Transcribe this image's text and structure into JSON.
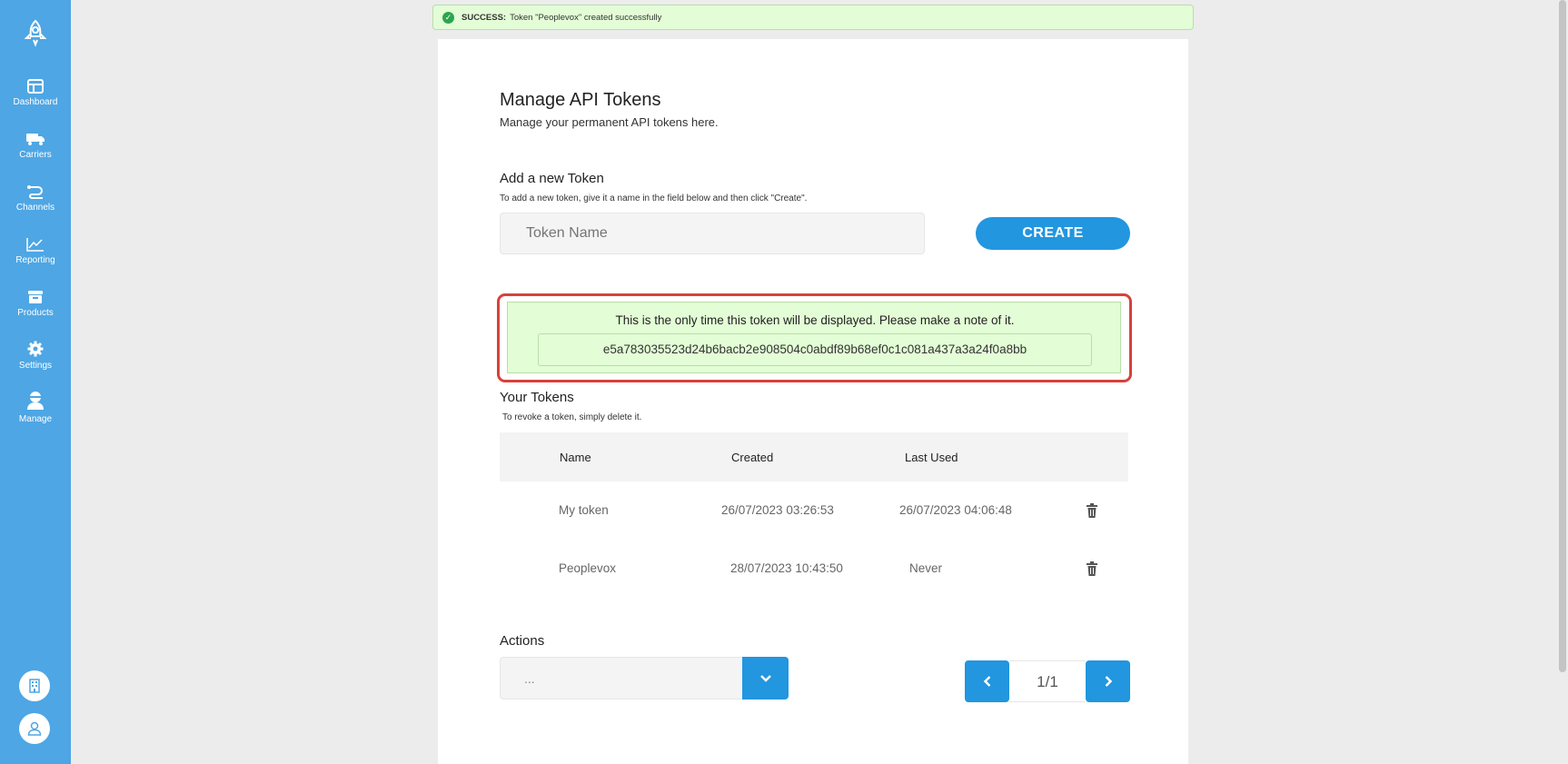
{
  "toast": {
    "strong": "SUCCESS:",
    "message": "Token \"Peoplevox\" created successfully"
  },
  "nav": [
    {
      "label": "Dashboard",
      "icon": "dashboard-icon"
    },
    {
      "label": "Carriers",
      "icon": "truck-icon"
    },
    {
      "label": "Channels",
      "icon": "channels-icon"
    },
    {
      "label": "Reporting",
      "icon": "chart-icon"
    },
    {
      "label": "Products",
      "icon": "box-icon"
    },
    {
      "label": "Settings",
      "icon": "gear-icon"
    },
    {
      "label": "Manage",
      "icon": "user-manage-icon"
    }
  ],
  "page": {
    "title": "Manage API Tokens",
    "subtitle": "Manage your permanent API tokens here."
  },
  "add_token": {
    "title": "Add a new Token",
    "help": "To add a new token, give it a name in the field below and then click \"Create\".",
    "placeholder": "Token Name",
    "create_label": "CREATE"
  },
  "notice": {
    "message": "This is the only time this token will be displayed. Please make a note of it.",
    "token": "e5a783035523d24b6bacb2e908504c0abdf89b68ef0c1c081a437a3a24f0a8bb"
  },
  "your_tokens": {
    "title": "Your Tokens",
    "help": "To revoke a token, simply delete it.",
    "columns": [
      "Name",
      "Created",
      "Last Used"
    ],
    "rows": [
      {
        "name": "My token",
        "created": "26/07/2023 03:26:53",
        "last_used": "26/07/2023 04:06:48"
      },
      {
        "name": "Peoplevox",
        "created": "28/07/2023 10:43:50",
        "last_used": "Never"
      }
    ]
  },
  "actions": {
    "title": "Actions",
    "selected": "..."
  },
  "pager": {
    "text": "1/1"
  },
  "colors": {
    "sidebar": "#4ea6e4",
    "accent": "#2296df",
    "success_bg": "#e3fdd6",
    "highlight_border": "#d6423b"
  }
}
